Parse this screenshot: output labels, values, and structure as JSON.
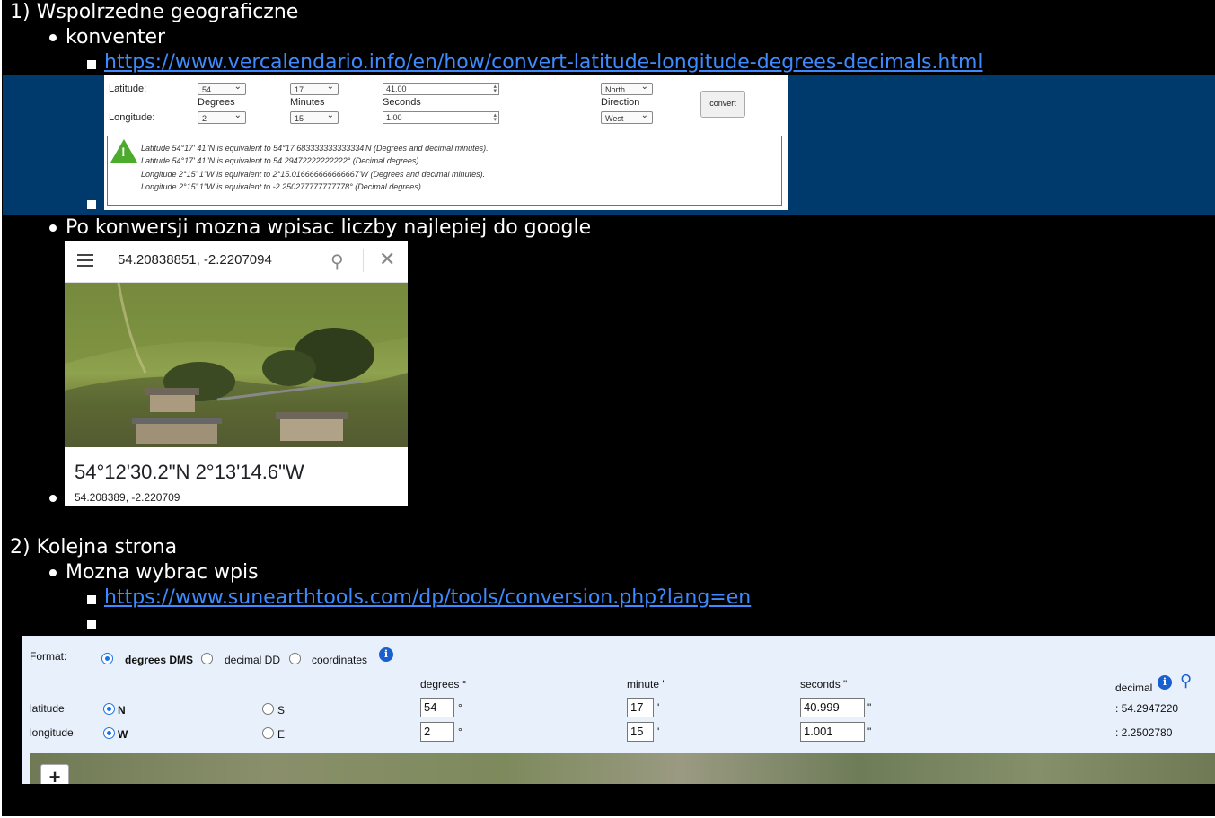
{
  "section1": {
    "heading": "1) Wspolrzedne geograficzne",
    "item1": "konventer",
    "link1": "https://www.vercalendario.info/en/how/convert-latitude-longitude-degrees-decimals.html",
    "item2": "Po konwersji mozna wpisac liczby najlepiej do google"
  },
  "converter": {
    "latitude_label": "Latitude:",
    "longitude_label": "Longitude:",
    "degrees_label": "Degrees",
    "minutes_label": "Minutes",
    "seconds_label": "Seconds",
    "direction_label": "Direction",
    "lat_degrees": "54",
    "lat_minutes": "17",
    "lat_seconds": "41.00",
    "lat_direction": "North",
    "lon_degrees": "2",
    "lon_minutes": "15",
    "lon_seconds": "1.00",
    "lon_direction": "West",
    "convert_button": "convert",
    "results": [
      "Latitude 54°17' 41\"N is equivalent to 54°17.683333333333334'N (Degrees and decimal minutes).",
      "Latitude 54°17' 41\"N is equivalent to 54.29472222222222° (Decimal degrees).",
      "Longitude 2°15' 1\"W is equivalent to 2°15.016666666666667'W (Degrees and decimal minutes).",
      "Longitude 2°15' 1\"W is equivalent to -2.250277777777778° (Decimal degrees)."
    ]
  },
  "google": {
    "query": "54.20838851, -2.2207094",
    "dms": "54°12'30.2\"N 2°13'14.6\"W",
    "decimal": "54.208389, -2.220709"
  },
  "section2": {
    "heading": "2) Kolejna strona",
    "item1": "Mozna wybrac wpis",
    "link1": "https://www.sunearthtools.com/dp/tools/conversion.php?lang=en"
  },
  "sunearth": {
    "format_label": "Format:",
    "opt_dms": "degrees DMS",
    "opt_dd": "decimal DD",
    "opt_coord": "coordinates",
    "degrees_header": "degrees °",
    "minute_header": "minute '",
    "seconds_header": "seconds \"",
    "decimal_header": "decimal",
    "latitude_label": "latitude",
    "longitude_label": "longitude",
    "lat_n": "N",
    "lat_s": "S",
    "lon_w": "W",
    "lon_e": "E",
    "lat_degrees": "54",
    "lat_minutes": "17",
    "lat_seconds": "40.999",
    "lon_degrees": "2",
    "lon_minutes": "15",
    "lon_seconds": "1.001",
    "deg_unit": "°",
    "min_unit": "'",
    "sec_unit": "\"",
    "lat_decimal": ": 54.2947220",
    "lon_decimal": ": 2.2502780",
    "zoom_in": "+"
  },
  "colors": {
    "background": "#000000",
    "highlight": "#003a6c",
    "link": "#3d8bff"
  }
}
